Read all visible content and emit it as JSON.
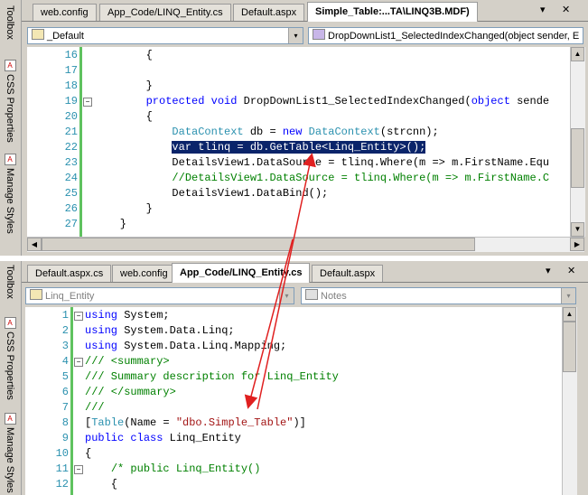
{
  "pane1": {
    "sidebar": [
      "Toolbox",
      "CSS Properties",
      "Manage Styles"
    ],
    "tabs": [
      "web.config",
      "App_Code/LINQ_Entity.cs",
      "Default.aspx",
      "Simple_Table:...TA\\LINQ3B.MDF)"
    ],
    "combo_left": "_Default",
    "combo_right": "DropDownList1_SelectedIndexChanged(object sender, E",
    "lines": [
      {
        "n": "16",
        "code": "        {"
      },
      {
        "n": "17",
        "code": ""
      },
      {
        "n": "18",
        "code": "        }"
      },
      {
        "n": "19",
        "code": "        protected void DropDownList1_SelectedIndexChanged(object sende"
      },
      {
        "n": "20",
        "code": "        {"
      },
      {
        "n": "21",
        "code": "            DataContext db = new DataContext(strcnn);"
      },
      {
        "n": "22",
        "code": "            var tlinq = db.GetTable<Linq_Entity>();"
      },
      {
        "n": "23",
        "code": "            DetailsView1.DataSource = tlinq.Where(m => m.FirstName.Equ"
      },
      {
        "n": "24",
        "code": "            //DetailsView1.DataSource = tlinq.Where(m => m.FirstName.C"
      },
      {
        "n": "25",
        "code": "            DetailsView1.DataBind();"
      },
      {
        "n": "26",
        "code": "        }"
      },
      {
        "n": "27",
        "code": "    }"
      }
    ]
  },
  "pane2": {
    "sidebar": [
      "Toolbox",
      "CSS Properties",
      "Manage Styles"
    ],
    "tabs": [
      "Default.aspx.cs",
      "web.config",
      "App_Code/LINQ_Entity.cs",
      "Default.aspx"
    ],
    "combo_left": "Linq_Entity",
    "combo_right": "Notes",
    "lines": [
      {
        "n": "1",
        "code": "using System;"
      },
      {
        "n": "2",
        "code": "using System.Data.Linq;"
      },
      {
        "n": "3",
        "code": "using System.Data.Linq.Mapping;"
      },
      {
        "n": "4",
        "code": "/// <summary>"
      },
      {
        "n": "5",
        "code": "/// Summary description for Linq_Entity"
      },
      {
        "n": "6",
        "code": "/// </summary>"
      },
      {
        "n": "7",
        "code": "///"
      },
      {
        "n": "8",
        "code": "[Table(Name = \"dbo.Simple_Table\")]"
      },
      {
        "n": "9",
        "code": "public class Linq_Entity"
      },
      {
        "n": "10",
        "code": "{"
      },
      {
        "n": "11",
        "code": "    /* public Linq_Entity()"
      },
      {
        "n": "12",
        "code": "    {"
      }
    ]
  },
  "controls": {
    "dropdown": "▾",
    "close": "✕",
    "up": "▲",
    "down": "▼",
    "left": "◀",
    "right": "▶"
  },
  "colors": {
    "keyword": "#0000ff",
    "type": "#2b91af",
    "comment": "#008000",
    "string": "#a31515",
    "selection": "#0a246a",
    "arrow": "#e02020"
  }
}
